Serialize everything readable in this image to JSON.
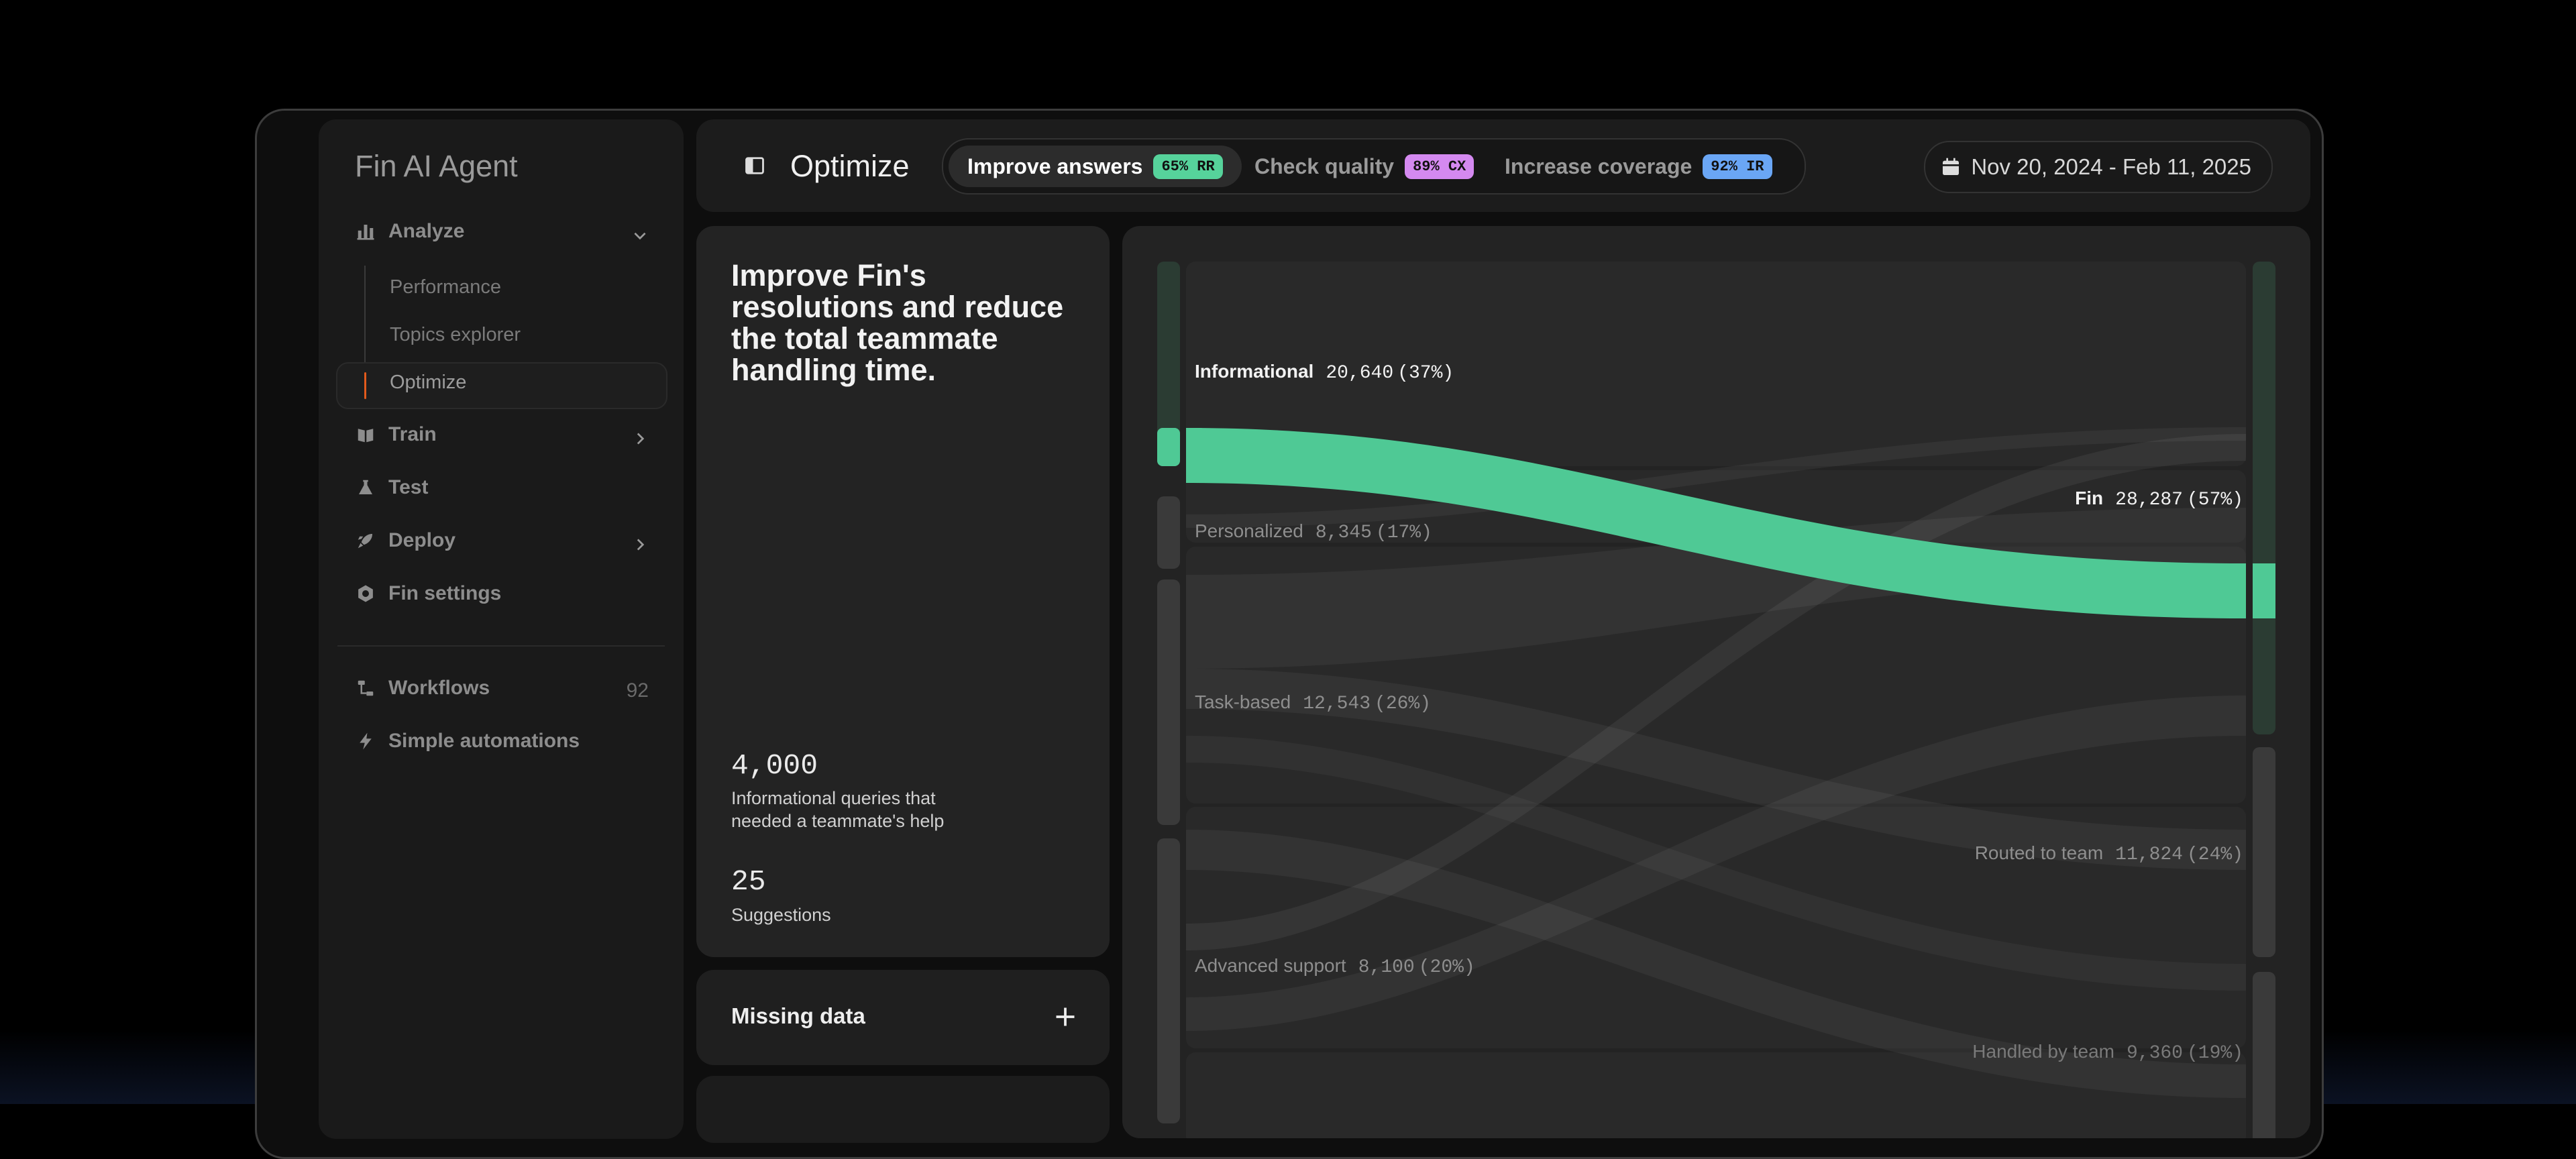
{
  "sidebar": {
    "brand": "Fin AI Agent",
    "analyze": "Analyze",
    "sub_items": [
      "Performance",
      "Topics explorer",
      "Optimize"
    ],
    "train": "Train",
    "test": "Test",
    "deploy": "Deploy",
    "fin_settings": "Fin settings",
    "workflows": "Workflows",
    "workflows_count": "92",
    "simple_automations": "Simple automations"
  },
  "header": {
    "title": "Optimize",
    "tabs": [
      {
        "label": "Improve answers",
        "badge": "65% RR",
        "badge_color": "#56d39b"
      },
      {
        "label": "Check quality",
        "badge": "89% CX",
        "badge_color": "#d489f0"
      },
      {
        "label": "Increase coverage",
        "badge": "92% IR",
        "badge_color": "#6aa6f5"
      }
    ],
    "date_range": "Nov 20, 2024 - Feb 11, 2025"
  },
  "summary": {
    "headline": "Improve Fin's resolutions and reduce the total teammate handling time.",
    "stat1_value": "4,000",
    "stat1_label": "Informational queries that needed a teammate's help",
    "stat2_value": "25",
    "stat2_label": "Suggestions"
  },
  "missing_data": {
    "label": "Missing data"
  },
  "chart_data": {
    "type": "sankey",
    "sources": [
      {
        "name": "Informational",
        "value": "20,640",
        "percent": "(37%)"
      },
      {
        "name": "Personalized",
        "value": "8,345",
        "percent": "(17%)"
      },
      {
        "name": "Task-based",
        "value": "12,543",
        "percent": "(26%)"
      },
      {
        "name": "Advanced support",
        "value": "8,100",
        "percent": "(20%)"
      }
    ],
    "targets": [
      {
        "name": "Fin",
        "value": "28,287",
        "percent": "(57%)"
      },
      {
        "name": "Routed to team",
        "value": "11,824",
        "percent": "(24%)"
      },
      {
        "name": "Handled by team",
        "value": "9,360",
        "percent": "(19%)"
      }
    ],
    "highlight_flow": {
      "source": "Informational",
      "target": "Fin"
    },
    "highlight_color": "#4fc995"
  }
}
